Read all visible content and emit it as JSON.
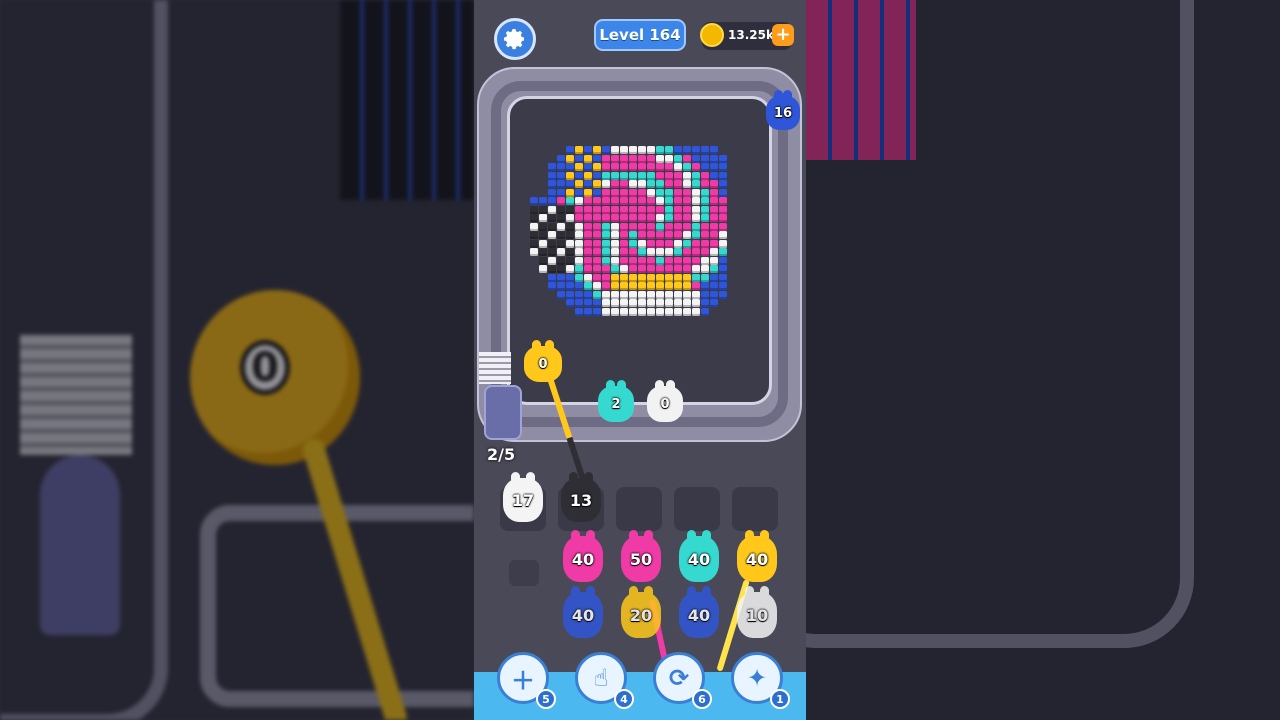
{
  "hud": {
    "level_label": "Level 164",
    "coins": "13.25k",
    "add_coins_symbol": "+",
    "settings_icon": "gear-icon"
  },
  "board": {
    "queue_counter": "2/5",
    "conveyor_blob_count": "16",
    "yellow_handle_count": "0",
    "track_blobs": [
      {
        "value": "2",
        "color": "#35d9d0"
      },
      {
        "value": "0",
        "color": "#f2f2f2"
      }
    ],
    "holding_slots": [
      {
        "value": "17",
        "color": "#f4f4f4"
      },
      {
        "value": "13",
        "color": "#2e2e34"
      },
      {
        "value": "",
        "color": ""
      },
      {
        "value": "",
        "color": ""
      },
      {
        "value": "",
        "color": ""
      }
    ],
    "grid": [
      {
        "value": "40",
        "color": "#f03aa6"
      },
      {
        "value": "50",
        "color": "#f03aa6"
      },
      {
        "value": "40",
        "color": "#35d9d0"
      },
      {
        "value": "40",
        "color": "#ffc81a"
      },
      {
        "value": "40",
        "color": "#2f56d8"
      },
      {
        "value": "20",
        "color": "#ffc81a"
      },
      {
        "value": "40",
        "color": "#2f56d8"
      },
      {
        "value": "10",
        "color": "#f4f4f4"
      }
    ]
  },
  "boosters": [
    {
      "icon": "add-slot-icon",
      "count": "5"
    },
    {
      "icon": "hand-pick-icon",
      "count": "4"
    },
    {
      "icon": "shuffle-icon",
      "count": "6"
    },
    {
      "icon": "magic-blob-icon",
      "count": "1"
    }
  ],
  "colors": {
    "blue": "#2f56d8",
    "pink": "#f03aa6",
    "cyan": "#35d9d0",
    "yellow": "#ffc81a",
    "white": "#f4f4f4",
    "black": "#2e2e34"
  }
}
